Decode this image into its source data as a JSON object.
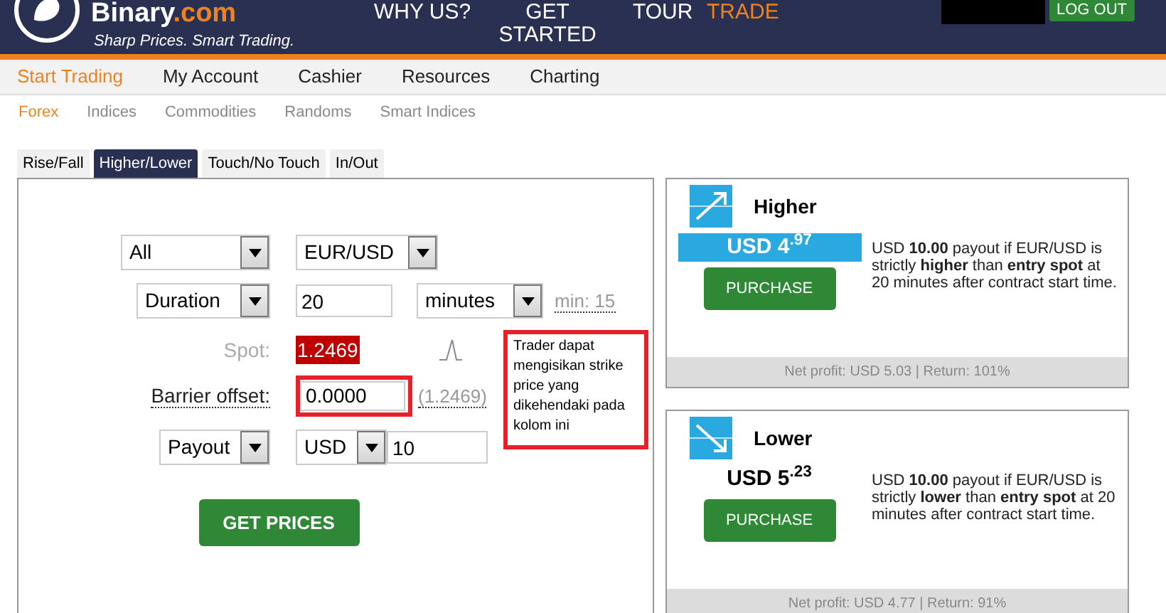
{
  "header": {
    "logo": {
      "name": "Binary",
      "suffix": ".com",
      "tagline": "Sharp Prices. Smart Trading."
    },
    "nav": [
      {
        "label": "WHY US?",
        "selected": false
      },
      {
        "label": "GET STARTED",
        "selected": false
      },
      {
        "label": "TOUR",
        "selected": false
      },
      {
        "label": "TRADE",
        "selected": true
      }
    ],
    "logout": "LOG OUT"
  },
  "main_menu": [
    {
      "label": "Start Trading",
      "selected": true
    },
    {
      "label": "My Account",
      "selected": false
    },
    {
      "label": "Cashier",
      "selected": false
    },
    {
      "label": "Resources",
      "selected": false
    },
    {
      "label": "Charting",
      "selected": false
    }
  ],
  "sub_menu": [
    {
      "label": "Forex",
      "selected": true
    },
    {
      "label": "Indices",
      "selected": false
    },
    {
      "label": "Commodities",
      "selected": false
    },
    {
      "label": "Randoms",
      "selected": false
    },
    {
      "label": "Smart Indices",
      "selected": false
    }
  ],
  "contract_tabs": [
    {
      "label": "Rise/Fall",
      "selected": false
    },
    {
      "label": "Higher/Lower",
      "selected": true
    },
    {
      "label": "Touch/No Touch",
      "selected": false
    },
    {
      "label": "In/Out",
      "selected": false
    }
  ],
  "form": {
    "market": "All",
    "underlying": "EUR/USD",
    "duration_type": "Duration",
    "duration": "20",
    "duration_unit": "minutes",
    "min_duration": "min: 15",
    "spot_label": "Spot:",
    "spot": "1.2469",
    "barrier_label": "Barrier offset:",
    "barrier": "0.0000",
    "barrier_value": "(1.2469)",
    "amount_type": "Payout",
    "currency": "USD",
    "amount": "10",
    "button": "GET PRICES"
  },
  "annotation": {
    "text": "Trader dapat mengisikan strike price yang dikehendaki pada kolom ini"
  },
  "contracts": [
    {
      "kind": "higher",
      "title": "Higher",
      "price": "USD 4$^{.97}$",
      "highlighted": true,
      "button": "PURCHASE",
      "description": "USD **10.00** payout if EUR/USD is strictly **higher** than **entry spot** at 20 minutes after contract start time.",
      "footer": "Net profit: USD 5.03 | Return: 101%"
    },
    {
      "kind": "lower",
      "title": "Lower",
      "price": "USD 5$^{.23}$",
      "highlighted": false,
      "button": "PURCHASE",
      "description": "USD **10.00** payout if EUR/USD is strictly **lower** than **entry spot** at 20 minutes after contract start time.",
      "footer": "Net profit: USD 4.77 | Return: 91%"
    }
  ]
}
